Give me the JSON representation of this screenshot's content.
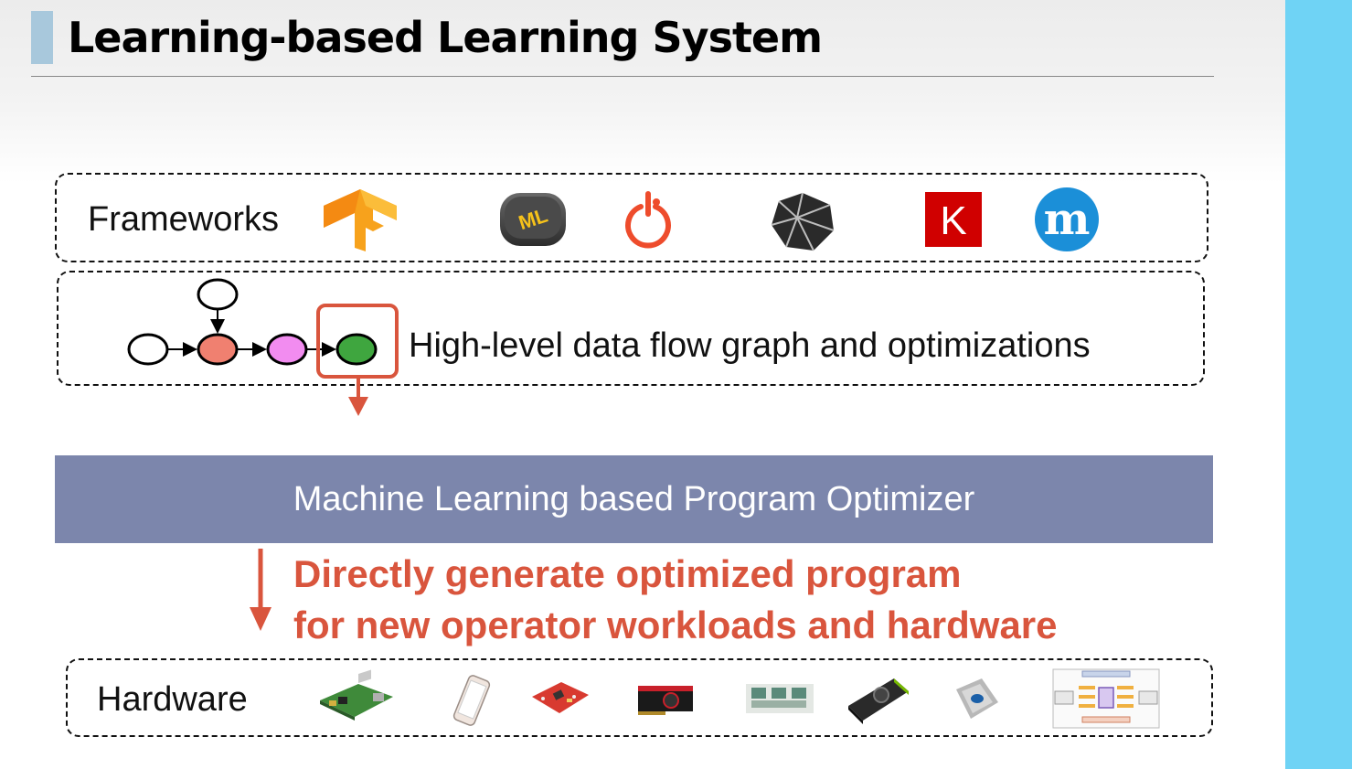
{
  "title": "Learning-based Learning System",
  "frameworks": {
    "label": "Frameworks",
    "logos": [
      "tensorflow-logo",
      "coreml-logo",
      "pytorch-logo",
      "onnx-logo",
      "keras-logo",
      "mxnet-logo"
    ],
    "coreml_text": "ML",
    "keras_text": "K",
    "mxnet_text": "m"
  },
  "graph": {
    "label": "High-level data flow graph and optimizations"
  },
  "optimizer": {
    "label": "Machine Learning based Program Optimizer"
  },
  "direct": {
    "line1": "Directly generate optimized program",
    "line2": "for new operator workloads and hardware"
  },
  "hardware": {
    "label": "Hardware",
    "devices": [
      "raspberry-pi",
      "iphone",
      "fpga-board",
      "amd-gpu",
      "tpu-board",
      "nvidia-gpu",
      "intel-xeon",
      "accelerator-diagram"
    ]
  },
  "colors": {
    "accent": "#d9553d",
    "optimizer_bg": "#7c86ac",
    "side_bar": "#6fd3f5",
    "node_red": "#f08070",
    "node_pink": "#f28cf0",
    "node_green": "#3fa63f"
  }
}
